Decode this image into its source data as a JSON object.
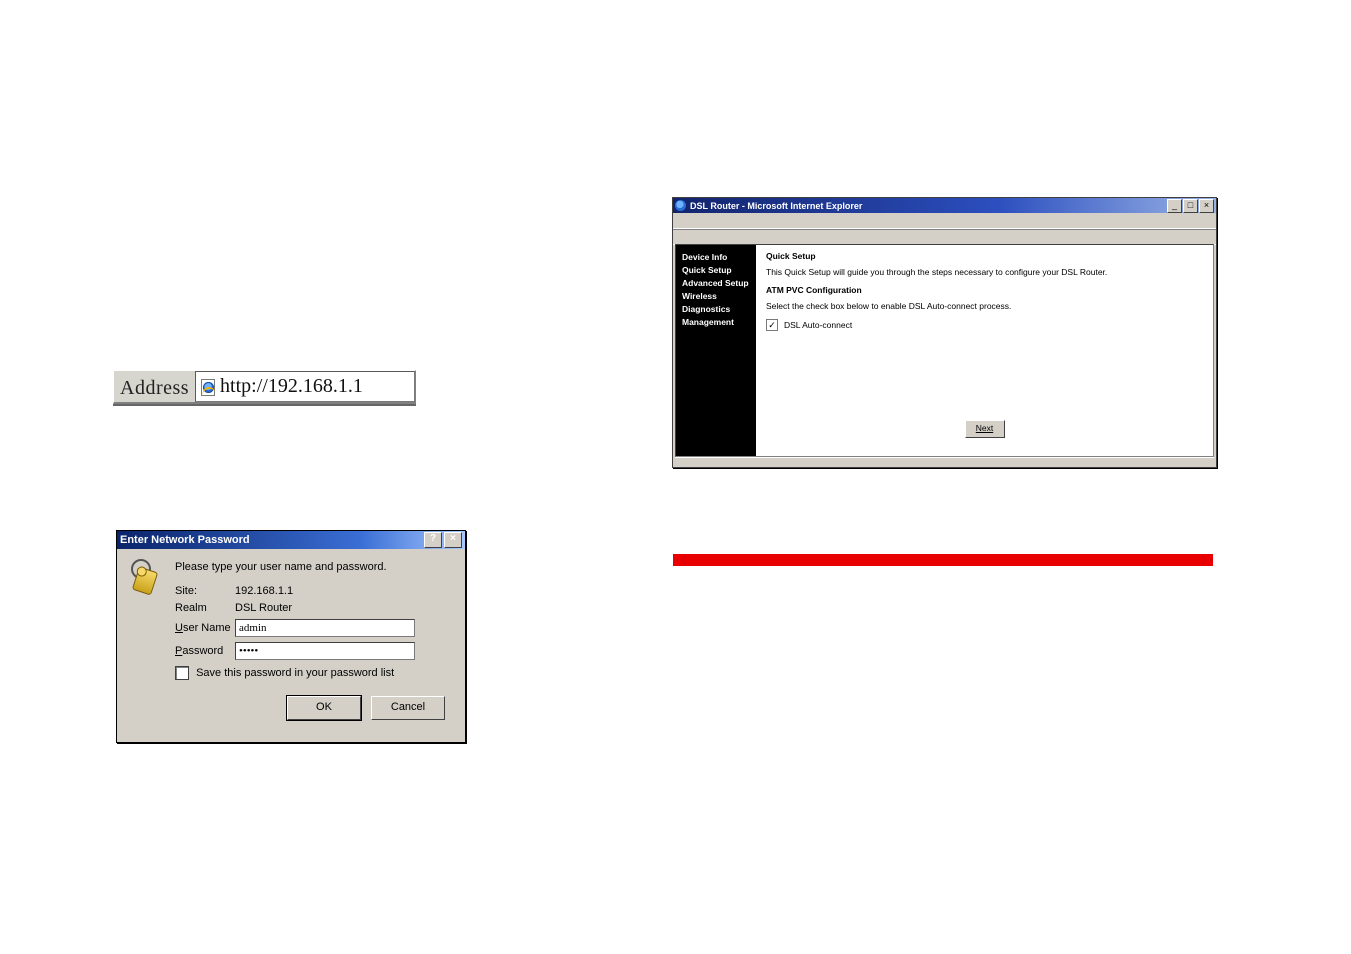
{
  "address_bar": {
    "label": "Address",
    "url": "http://192.168.1.1"
  },
  "router_window": {
    "title": "DSL Router - Microsoft Internet Explorer",
    "controls": {
      "min": "_",
      "max": "□",
      "close": "×"
    },
    "sidebar": {
      "items": [
        {
          "label": "Device Info"
        },
        {
          "label": "Quick Setup"
        },
        {
          "label": "Advanced Setup"
        },
        {
          "label": "Wireless"
        },
        {
          "label": "Diagnostics"
        },
        {
          "label": "Management"
        }
      ]
    },
    "content": {
      "heading": "Quick Setup",
      "intro": "This Quick Setup will guide you through the steps necessary to configure your DSL Router.",
      "section": "ATM PVC Configuration",
      "instruction": "Select the check box below to enable DSL Auto-connect process.",
      "checkbox_checked": true,
      "checkbox_label": "DSL Auto-connect",
      "next_label": "Next"
    }
  },
  "password_dialog": {
    "title": "Enter Network Password",
    "help_btn": "?",
    "close_btn": "×",
    "prompt": "Please type your user name and password.",
    "rows": {
      "site_label": "Site:",
      "site_value": "192.168.1.1",
      "realm_label": "Realm",
      "realm_value": "DSL Router",
      "user_label_pre": "U",
      "user_label_post": "ser Name",
      "user_value": "admin",
      "pass_label_pre": "P",
      "pass_label_post": "assword",
      "pass_value": "•••••"
    },
    "save_label_pre": "S",
    "save_label_post": "ave this password in your password list",
    "save_checked": false,
    "ok_label": "OK",
    "cancel_label": "Cancel"
  }
}
